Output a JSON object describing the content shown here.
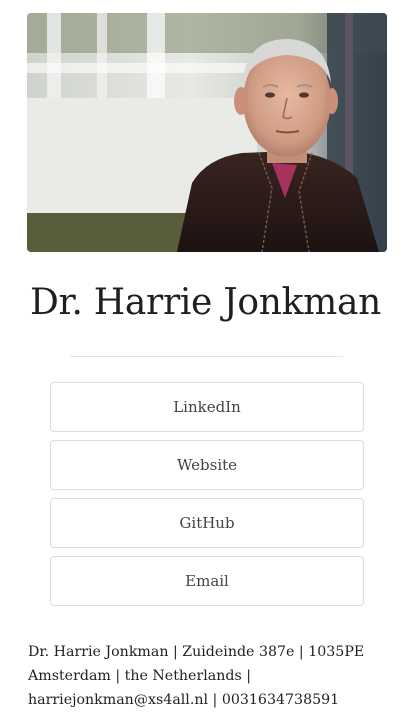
{
  "profile": {
    "photo_alt": "Portrait of Dr. Harrie Jonkman",
    "name": "Dr. Harrie Jonkman"
  },
  "links": [
    {
      "label": "LinkedIn"
    },
    {
      "label": "Website"
    },
    {
      "label": "GitHub"
    },
    {
      "label": "Email"
    }
  ],
  "footer": {
    "text": "Dr. Harrie Jonkman | Zuideinde 387e | 1035PE Amsterdam | the Netherlands | harriejonkman@xs4all.nl | 0031634738591"
  }
}
